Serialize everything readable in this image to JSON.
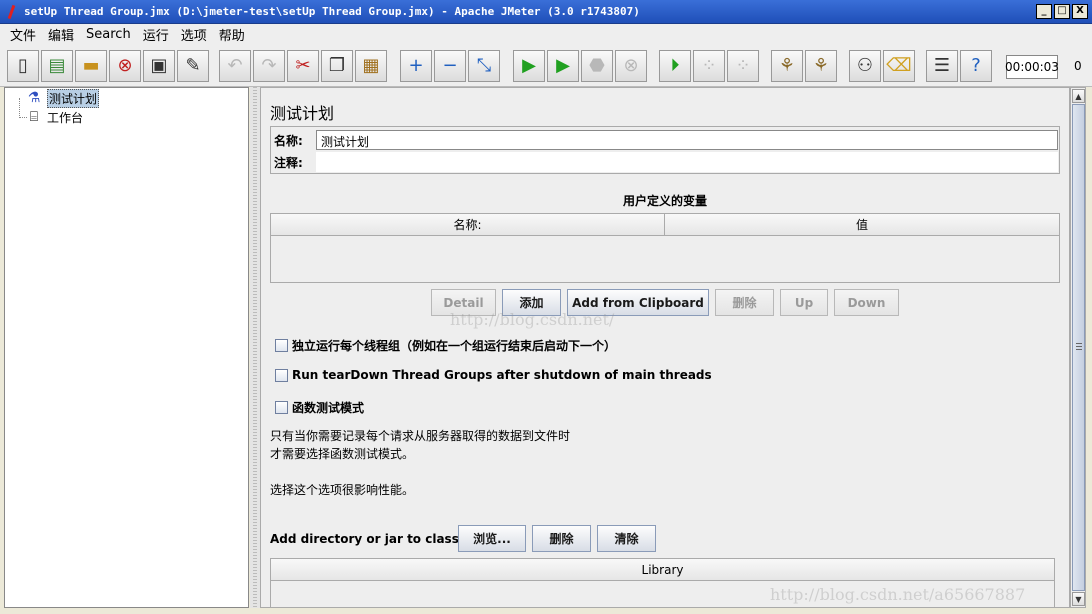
{
  "window": {
    "title": "setUp Thread Group.jmx (D:\\jmeter-test\\setUp Thread Group.jmx) - Apache JMeter (3.0 r1743807)",
    "minimize": "_",
    "maximize": "□",
    "close": "X"
  },
  "menu": [
    "文件",
    "编辑",
    "Search",
    "运行",
    "选项",
    "帮助"
  ],
  "toolbar": {
    "timer": "00:00:03",
    "counter": "0",
    "icons": [
      "new-icon",
      "templates-icon",
      "open-icon",
      "close-icon",
      "save-icon",
      "save-as-icon",
      "undo-icon",
      "redo-icon",
      "cut-icon",
      "copy-icon",
      "paste-icon",
      "expand-icon",
      "collapse-icon",
      "toggle-icon",
      "start-icon",
      "start-no-pause-icon",
      "stop-icon",
      "shutdown-icon",
      "remote-start-icon",
      "remote-stop-icon",
      "remote-shutdown-icon",
      "clear-icon",
      "clear-all-icon",
      "search-icon",
      "reset-search-icon",
      "function-helper-icon",
      "help-icon"
    ]
  },
  "tree": {
    "items": [
      {
        "label": "测试计划",
        "icon": "test-plan-icon",
        "selected": true
      },
      {
        "label": "工作台",
        "icon": "workbench-icon",
        "selected": false
      }
    ]
  },
  "panel": {
    "title": "测试计划",
    "name_label": "名称:",
    "name_value": "测试计划",
    "comment_label": "注释:",
    "comment_value": "",
    "vars_title": "用户定义的变量",
    "vars_col_name": "名称:",
    "vars_col_value": "值",
    "btn_detail": "Detail",
    "btn_add": "添加",
    "btn_add_clipboard": "Add from Clipboard",
    "btn_delete": "删除",
    "btn_up": "Up",
    "btn_down": "Down",
    "check_serial": "独立运行每个线程组（例如在一个组运行结束后启动下一个）",
    "check_teardown": "Run tearDown Thread Groups after shutdown of main threads",
    "check_functional": "函数测试模式",
    "note_line1": "只有当你需要记录每个请求从服务器取得的数据到文件时",
    "note_line2": "才需要选择函数测试模式。",
    "note_line3": "选择这个选项很影响性能。",
    "classpath_label": "Add directory or jar to classpath",
    "btn_browse": "浏览...",
    "btn_cp_delete": "删除",
    "btn_clear": "清除",
    "lib_col": "Library"
  },
  "watermark": {
    "center": "http://blog.csdn.net/",
    "corner": "http://blog.csdn.net/a65667887"
  }
}
